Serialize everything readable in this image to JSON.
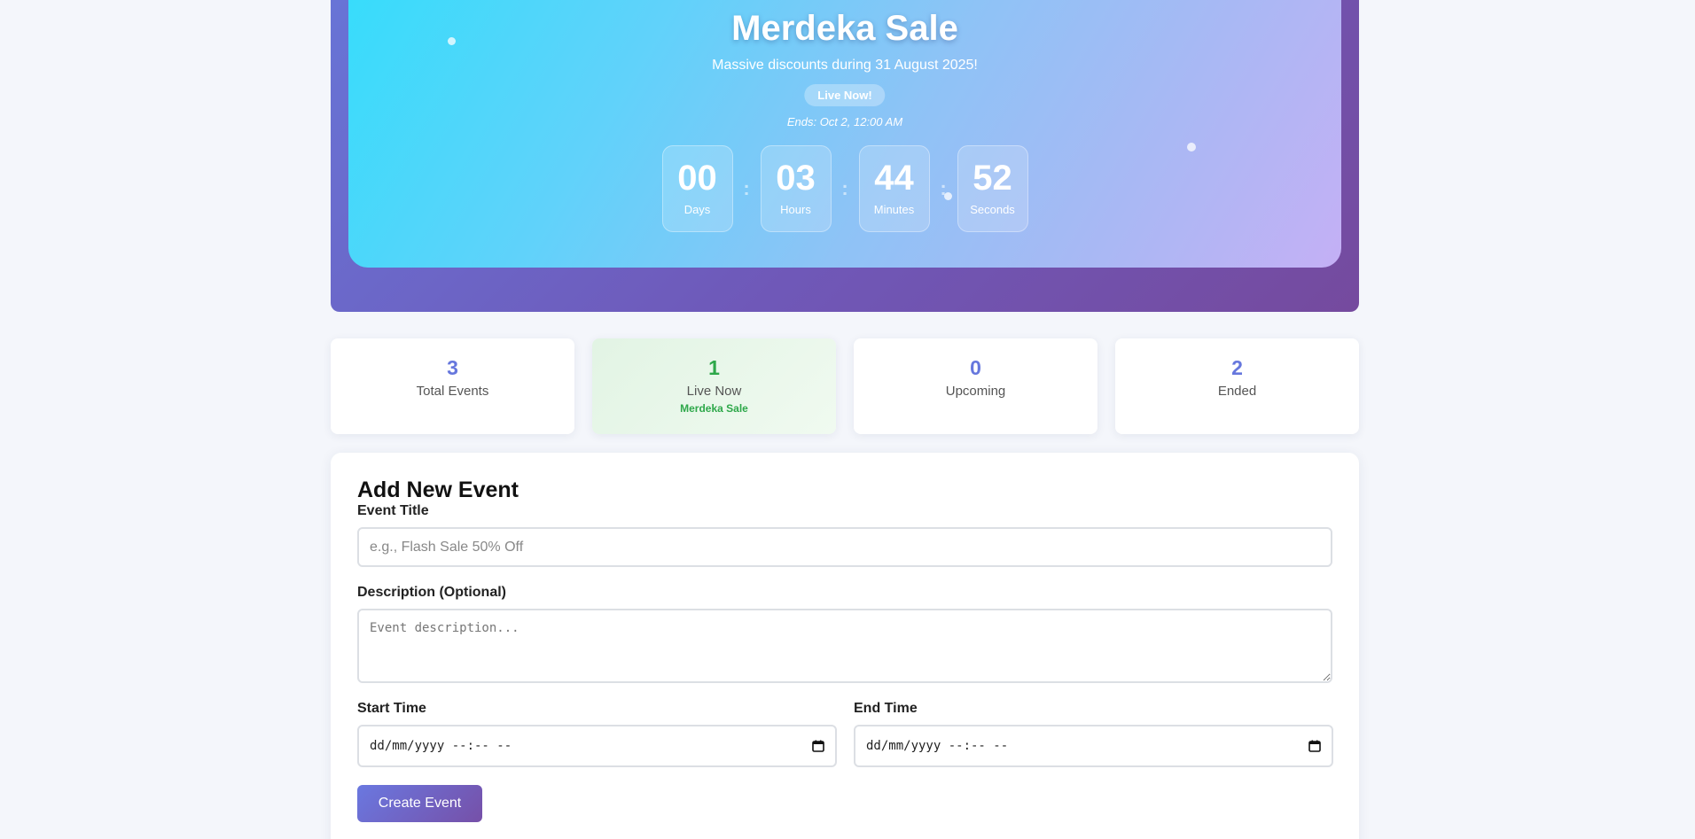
{
  "hero": {
    "title": "Merdeka Sale",
    "subtitle": "Massive discounts during 31 August 2025!",
    "badge": "Live Now!",
    "ends": "Ends: Oct 2, 12:00 AM",
    "countdown": {
      "days": {
        "value": "00",
        "label": "Days"
      },
      "hours": {
        "value": "03",
        "label": "Hours"
      },
      "minutes": {
        "value": "44",
        "label": "Minutes"
      },
      "seconds": {
        "value": "52",
        "label": "Seconds"
      },
      "separator": ":"
    }
  },
  "stats": {
    "total": {
      "value": "3",
      "label": "Total Events"
    },
    "live": {
      "value": "1",
      "label": "Live Now",
      "event": "Merdeka Sale"
    },
    "upcoming": {
      "value": "0",
      "label": "Upcoming"
    },
    "ended": {
      "value": "2",
      "label": "Ended"
    }
  },
  "form": {
    "title": "Add New Event",
    "event_title_label": "Event Title",
    "event_title_placeholder": "e.g., Flash Sale 50% Off",
    "description_label": "Description (Optional)",
    "description_placeholder": "Event description...",
    "start_label": "Start Time",
    "start_value": "dd/mm/yyyy --:-- --",
    "end_label": "End Time",
    "end_value": "dd/mm/yyyy --:-- --",
    "submit_label": "Create Event"
  },
  "colors": {
    "accent": "#6677dd",
    "live_green": "#2ea84a",
    "hero_start": "#38dcfb",
    "hero_end": "#c4b0f5",
    "hero_frame": "#6f58b8"
  },
  "icons": {
    "date_picker": "calendar-icon"
  }
}
